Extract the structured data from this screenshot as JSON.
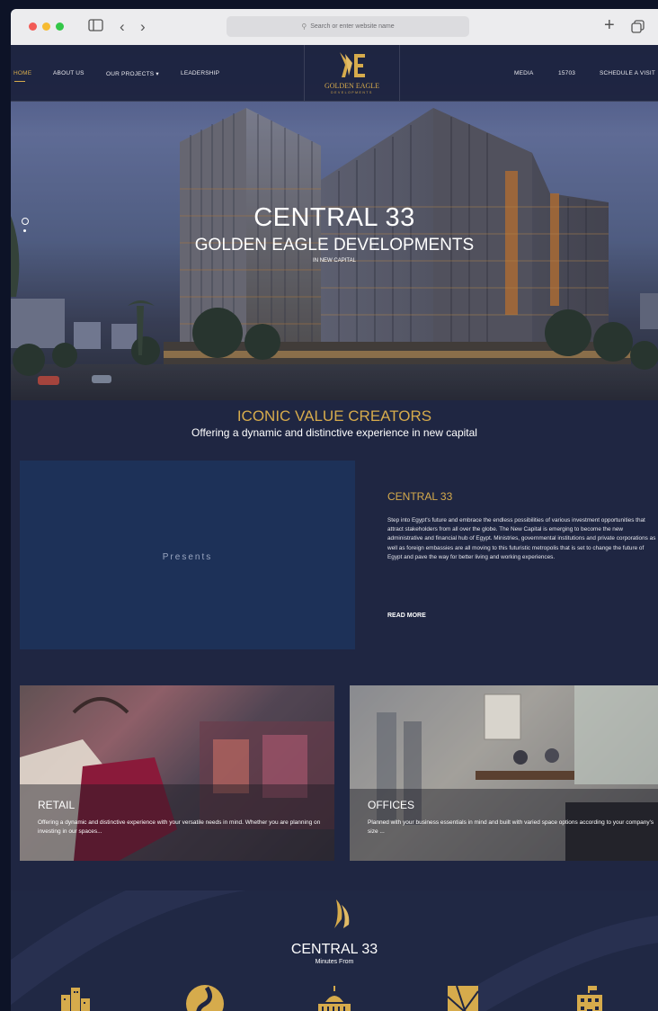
{
  "browser": {
    "url_placeholder": "Search or enter website name",
    "traffic_colors": [
      "#f25b56",
      "#f6bb32",
      "#33c748"
    ]
  },
  "nav": {
    "home": "HOME",
    "about": "ABOUT US",
    "projects": "OUR PROJECTS ▾",
    "leadership": "LEADERSHIP",
    "media": "MEDIA",
    "hotline": "15703",
    "schedule": "SCHEDULE A VISIT",
    "logo_line1": "GOLDEN EAGLE",
    "logo_line2": "DEVELOPMENTS"
  },
  "hero": {
    "title": "CENTRAL 33",
    "subtitle": "GOLDEN EAGLE DEVELOPMENTS",
    "location": "IN NEW CAPITAL"
  },
  "iconic": {
    "title": "ICONIC VALUE CREATORS",
    "subtitle": "Offering a dynamic and distinctive experience in new capital"
  },
  "presents": {
    "video_label": "Presents",
    "title": "CENTRAL 33",
    "body": "Step into Egypt's future and embrace the endless possibilities of various investment opportunities that attract stakeholders from all over the globe. The New Capital is emerging to become the new administrative and financial hub of Egypt. Ministries, governmental institutions and private corporations as well as foreign embassies are all moving to this futuristic metropolis that is set to change the future of Egypt and pave the way for better living and working experiences.",
    "read_more": "READ MORE"
  },
  "cards": [
    {
      "title": "RETAIL",
      "desc": "Offering a dynamic and distinctive experience with your versatile needs in mind. Whether you are planning on investing in our spaces..."
    },
    {
      "title": "OFFICES",
      "desc": "Planned with your business essentials in mind and built with varied space options according to your company's size ..."
    }
  ],
  "minutes": {
    "title": "CENTRAL 33",
    "subtitle": "Minutes From"
  },
  "colors": {
    "gold": "#d6ab4c",
    "navy": "#1f2642"
  },
  "icons": [
    "city-icon",
    "road-icon",
    "capitol-icon",
    "map-icon",
    "government-building-icon"
  ]
}
